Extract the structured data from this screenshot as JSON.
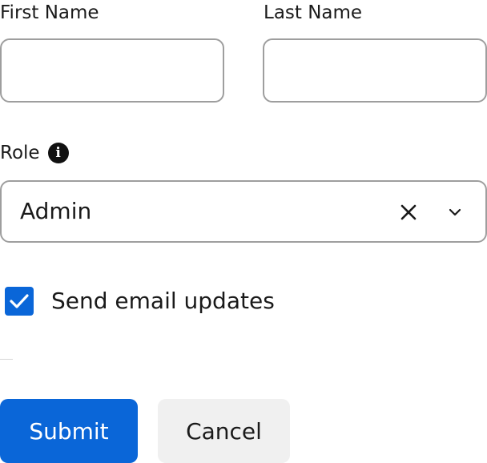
{
  "form": {
    "first_name": {
      "label": "First Name",
      "value": "",
      "placeholder": ""
    },
    "last_name": {
      "label": "Last Name",
      "value": "",
      "placeholder": ""
    },
    "role": {
      "label": "Role",
      "info_icon": "info-icon",
      "selected_value": "Admin",
      "clear_icon": "close-icon",
      "dropdown_icon": "chevron-down-icon"
    },
    "email_updates": {
      "label": "Send email updates",
      "checked": true
    },
    "submit_label": "Submit",
    "cancel_label": "Cancel"
  },
  "colors": {
    "primary": "#0a66d8",
    "border": "#9e9e9e",
    "secondary_button": "#f0f0f0",
    "text": "#1a1a1a"
  }
}
